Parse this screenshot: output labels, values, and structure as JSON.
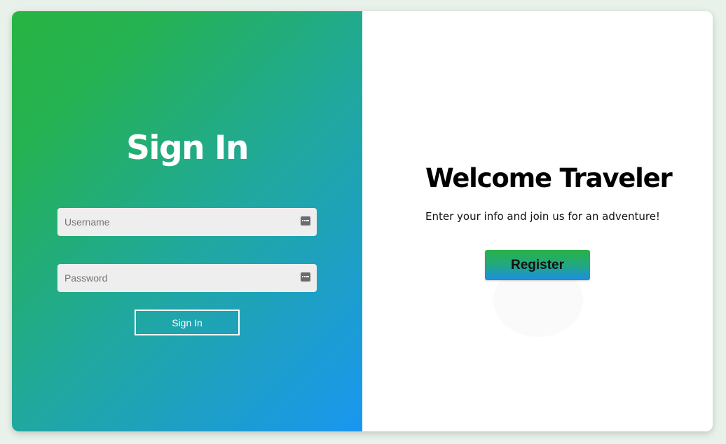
{
  "signin": {
    "title": "Sign In",
    "username_placeholder": "Username",
    "password_placeholder": "Password",
    "button_label": "Sign In"
  },
  "welcome": {
    "title": "Welcome Traveler",
    "text": "Enter your info and join us for an adventure!",
    "register_label": "Register"
  },
  "icons": {
    "field_icon": "password-manager-key-icon"
  },
  "colors": {
    "gradient_start": "#28b442",
    "gradient_end": "#1a96f0",
    "page_background": "#e8f1ea"
  }
}
